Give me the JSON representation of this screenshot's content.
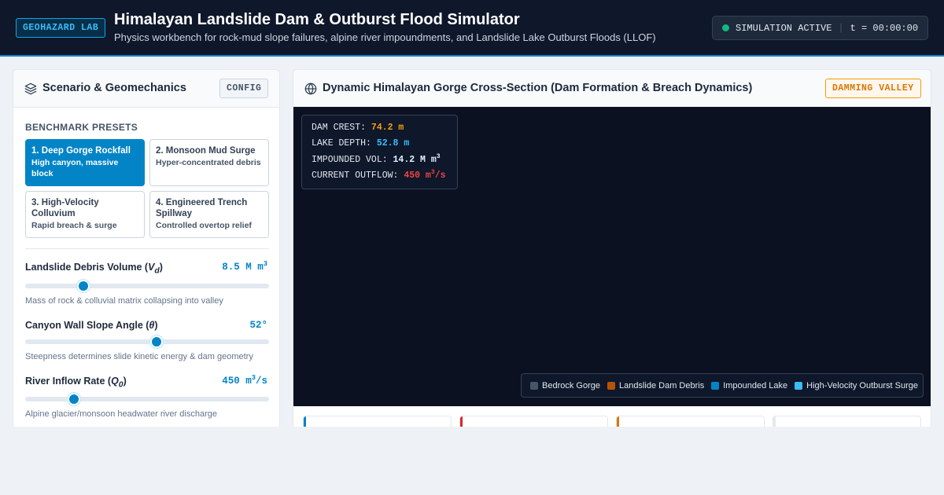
{
  "header": {
    "badge": "GEOHAZARD LAB",
    "title": "Himalayan Landslide Dam & Outburst Flood Simulator",
    "subtitle": "Physics workbench for rock-mud slope failures, alpine river impoundments, and Landslide Lake Outburst Floods (LLOF)",
    "status_text": "SIMULATION ACTIVE",
    "clock": "t = 00:00:00",
    "status_color": "#10b981"
  },
  "left_panel": {
    "title": "Scenario & Geomechanics",
    "config_label": "CONFIG",
    "presets_label": "BENCHMARK PRESETS",
    "presets": [
      {
        "title": "1. Deep Gorge Rockfall",
        "desc": "High canyon, massive block",
        "active": true
      },
      {
        "title": "2. Monsoon Mud Surge",
        "desc": "Hyper-concentrated debris",
        "active": false
      },
      {
        "title": "3. High-Velocity Colluvium",
        "desc": "Rapid breach & surge",
        "active": false
      },
      {
        "title": "4. Engineered Trench Spillway",
        "desc": "Controlled overtop relief",
        "active": false
      }
    ],
    "params": [
      {
        "label": "Landslide Debris Volume",
        "symbol": "V",
        "subscript": "d",
        "value": "8.5 M m",
        "unit_sup": "3",
        "help": "Mass of rock & colluvial matrix collapsing into valley",
        "fraction": 0.24
      },
      {
        "label": "Canyon Wall Slope Angle",
        "symbol": "θ",
        "subscript": "",
        "value": "52°",
        "unit_sup": "",
        "help": "Steepness determines slide kinetic energy & dam geometry",
        "fraction": 0.54
      },
      {
        "label": "River Inflow Rate",
        "symbol": "Q",
        "subscript": "0",
        "value": "450 m",
        "unit_sup": "3",
        "unit_tail": "/s",
        "help": "Alpine glacier/monsoon headwater river discharge",
        "fraction": 0.2
      }
    ]
  },
  "right_panel": {
    "title": "Dynamic Himalayan Gorge Cross-Section (Dam Formation & Breach Dynamics)",
    "mode_badge": "DAMMING VALLEY",
    "readout": {
      "crest_label": "DAM CREST:",
      "crest_value": "74.2 m",
      "depth_label": "LAKE DEPTH:",
      "depth_value": "52.8 m",
      "volume_label": "IMPOUNDED VOL:",
      "volume_value": "14.2 M m",
      "volume_sup": "3",
      "outflow_label": "CURRENT OUTFLOW:",
      "outflow_value": "450 m",
      "outflow_sup": "3",
      "outflow_tail": "/s"
    },
    "legend": [
      {
        "label": "Bedrock Gorge",
        "color": "#475569"
      },
      {
        "label": "Landslide Dam Debris",
        "color": "#b45309"
      },
      {
        "label": "Impounded Lake",
        "color": "#0284c7"
      },
      {
        "label": "High-Velocity Outburst Surge",
        "color": "#38bdf8"
      }
    ],
    "metric_accents": [
      "#0284c7",
      "#dc2626",
      "#d97706",
      "#e2e8f0"
    ]
  },
  "colors": {
    "accent": "#0284c7",
    "crest": "#f59e0b",
    "depth": "#38bdf8",
    "volume": "#e0f2fe",
    "outflow": "#ef4444"
  }
}
